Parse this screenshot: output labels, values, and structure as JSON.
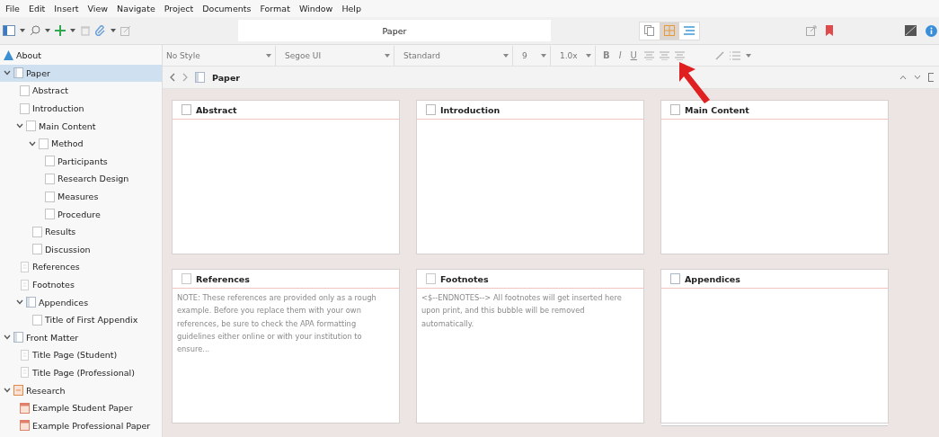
{
  "menu": [
    "File",
    "Edit",
    "Insert",
    "View",
    "Navigate",
    "Project",
    "Documents",
    "Format",
    "Window",
    "Help"
  ],
  "toolbar": {
    "title": "Paper",
    "view_modes": [
      {
        "kind": "scrivenings",
        "selected": false
      },
      {
        "kind": "corkboard",
        "selected": true
      },
      {
        "kind": "outline",
        "selected": false
      }
    ]
  },
  "sidebar": {
    "items": [
      {
        "label": "About",
        "kind": "about",
        "selected": false
      },
      {
        "label": "Paper",
        "kind": "folder",
        "selected": true,
        "expanded": true,
        "children": [
          {
            "label": "Abstract",
            "kind": "doc",
            "selected": false
          },
          {
            "label": "Introduction",
            "kind": "doc",
            "selected": false
          },
          {
            "label": "Main Content",
            "kind": "doc",
            "selected": false,
            "expanded": true,
            "children": [
              {
                "label": "Method",
                "kind": "doc",
                "selected": false,
                "expanded": true,
                "children": [
                  {
                    "label": "Participants",
                    "kind": "doc",
                    "selected": false
                  },
                  {
                    "label": "Research Design",
                    "kind": "doc",
                    "selected": false
                  },
                  {
                    "label": "Measures",
                    "kind": "doc",
                    "selected": false
                  },
                  {
                    "label": "Procedure",
                    "kind": "doc",
                    "selected": false
                  }
                ]
              },
              {
                "label": "Results",
                "kind": "doc",
                "selected": false
              },
              {
                "label": "Discussion",
                "kind": "doc",
                "selected": false
              }
            ]
          },
          {
            "label": "References",
            "kind": "page",
            "selected": false
          },
          {
            "label": "Footnotes",
            "kind": "page",
            "selected": false
          },
          {
            "label": "Appendices",
            "kind": "folder",
            "selected": false,
            "expanded": true,
            "children": [
              {
                "label": "Title of First Appendix",
                "kind": "doc",
                "selected": false
              }
            ]
          }
        ]
      },
      {
        "label": "Front Matter",
        "kind": "folder",
        "selected": false,
        "expanded": true,
        "children": [
          {
            "label": "Title Page (Student)",
            "kind": "page",
            "selected": false
          },
          {
            "label": "Title Page (Professional)",
            "kind": "page",
            "selected": false
          }
        ]
      },
      {
        "label": "Research",
        "kind": "research",
        "selected": false,
        "expanded": true,
        "children": [
          {
            "label": "Example Student Paper",
            "kind": "pdf",
            "selected": false
          },
          {
            "label": "Example Professional Paper",
            "kind": "pdf",
            "selected": false
          }
        ]
      }
    ]
  },
  "format_bar": {
    "style": "No Style",
    "font": "Segoe UI",
    "typeface": "Standard",
    "size": "9",
    "spacing": "1.0x",
    "bold": "B",
    "italic": "I",
    "underline": "U"
  },
  "breadcrumb": {
    "title": "Paper"
  },
  "cards": [
    {
      "title": "Abstract",
      "kind": "doc"
    },
    {
      "title": "Introduction",
      "kind": "doc"
    },
    {
      "title": "Main Content",
      "kind": "doc"
    },
    {
      "title": "References",
      "kind": "page",
      "synopsis": "NOTE: These references are provided only as a rough example. Before you replace them with your own references, be sure to check the APA formatting guidelines either online or with your institution to ensure..."
    },
    {
      "title": "Footnotes",
      "kind": "page",
      "synopsis": "<$--ENDNOTES--> All footnotes will get inserted here upon print, and this bubble will be removed automatically."
    },
    {
      "title": "Appendices",
      "kind": "folder"
    }
  ]
}
